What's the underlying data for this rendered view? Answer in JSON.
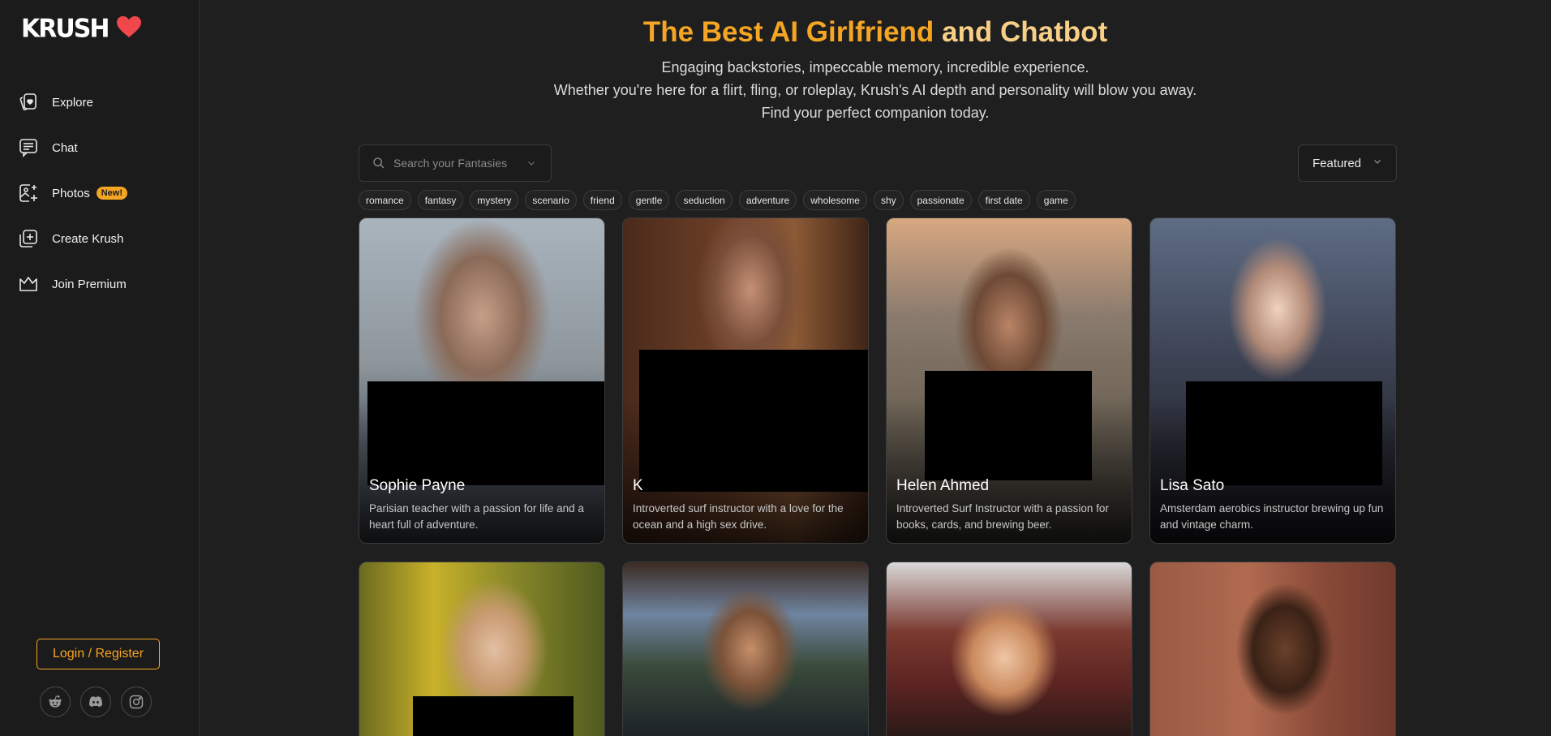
{
  "brand": {
    "logo_text": "KRUSH",
    "accent": "#f5a524"
  },
  "sidebar": {
    "items": [
      {
        "label": "Explore",
        "icon": "cards-heart-icon"
      },
      {
        "label": "Chat",
        "icon": "chat-icon"
      },
      {
        "label": "Photos",
        "icon": "photo-plus-icon",
        "badge": "New!"
      },
      {
        "label": "Create Krush",
        "icon": "plus-square-icon"
      },
      {
        "label": "Join Premium",
        "icon": "crown-icon"
      }
    ],
    "login_label": "Login / Register",
    "socials": [
      "reddit-icon",
      "discord-icon",
      "instagram-icon"
    ]
  },
  "hero": {
    "title_part1": "The Best AI Girlfriend",
    "title_part2": " and Chatbot",
    "subtitle": [
      "Engaging backstories, impeccable memory, incredible experience.",
      "Whether you're here for a flirt, fling, or roleplay, Krush's AI depth and personality will blow you away.",
      "Find your perfect companion today."
    ]
  },
  "search": {
    "placeholder": "Search your Fantasies"
  },
  "sort": {
    "selected": "Featured"
  },
  "tags": [
    "romance",
    "fantasy",
    "mystery",
    "scenario",
    "friend",
    "gentle",
    "seduction",
    "adventure",
    "wholesome",
    "shy",
    "passionate",
    "first date",
    "game"
  ],
  "cards": [
    {
      "name": "Sophie Payne",
      "description": "Parisian teacher with a passion for life and a heart full of adventure."
    },
    {
      "name": "K",
      "description": "Introverted surf instructor with a love for the ocean and a high sex drive."
    },
    {
      "name": "Helen Ahmed",
      "description": "Introverted Surf Instructor with a passion for books, cards, and brewing beer."
    },
    {
      "name": "Lisa Sato",
      "description": "Amsterdam aerobics instructor brewing up fun and vintage charm."
    },
    {
      "name": "",
      "description": ""
    },
    {
      "name": "",
      "description": ""
    },
    {
      "name": "",
      "description": ""
    },
    {
      "name": "",
      "description": ""
    }
  ]
}
